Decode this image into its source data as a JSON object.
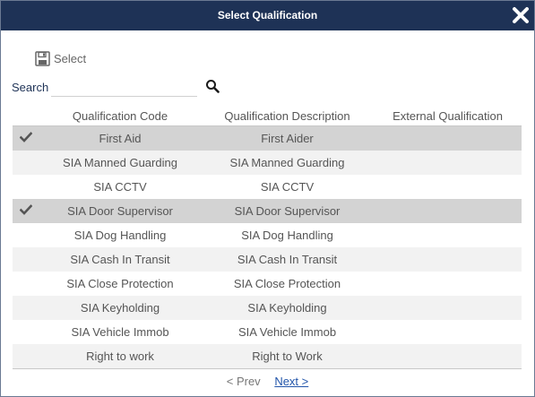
{
  "dialog": {
    "title": "Select Qualification",
    "close_icon": "close-icon"
  },
  "toolbar": {
    "select_label": "Select",
    "select_icon": "save-icon"
  },
  "search": {
    "label": "Search",
    "value": "",
    "placeholder": "",
    "icon": "search-icon"
  },
  "table": {
    "columns": [
      "",
      "Qualification Code",
      "Qualification Description",
      "External Qualification"
    ],
    "rows": [
      {
        "selected": true,
        "code": "First Aid",
        "description": "First Aider",
        "external": ""
      },
      {
        "selected": false,
        "code": "SIA Manned Guarding",
        "description": "SIA Manned Guarding",
        "external": ""
      },
      {
        "selected": false,
        "code": "SIA CCTV",
        "description": "SIA CCTV",
        "external": ""
      },
      {
        "selected": true,
        "code": "SIA Door Supervisor",
        "description": "SIA Door Supervisor",
        "external": ""
      },
      {
        "selected": false,
        "code": "SIA Dog Handling",
        "description": "SIA Dog Handling",
        "external": ""
      },
      {
        "selected": false,
        "code": "SIA Cash In Transit",
        "description": "SIA Cash In Transit",
        "external": ""
      },
      {
        "selected": false,
        "code": "SIA Close Protection",
        "description": "SIA Close Protection",
        "external": ""
      },
      {
        "selected": false,
        "code": "SIA Keyholding",
        "description": "SIA Keyholding",
        "external": ""
      },
      {
        "selected": false,
        "code": "SIA Vehicle Immob",
        "description": "SIA Vehicle Immob",
        "external": ""
      },
      {
        "selected": false,
        "code": "Right to work",
        "description": "Right to Work",
        "external": ""
      }
    ]
  },
  "pager": {
    "prev_label": "< Prev",
    "next_label": "Next >"
  },
  "colors": {
    "titlebar": "#1e3256",
    "selected_row": "#d3d3d3",
    "alt_row": "#f2f2f2",
    "link": "#2255aa"
  }
}
